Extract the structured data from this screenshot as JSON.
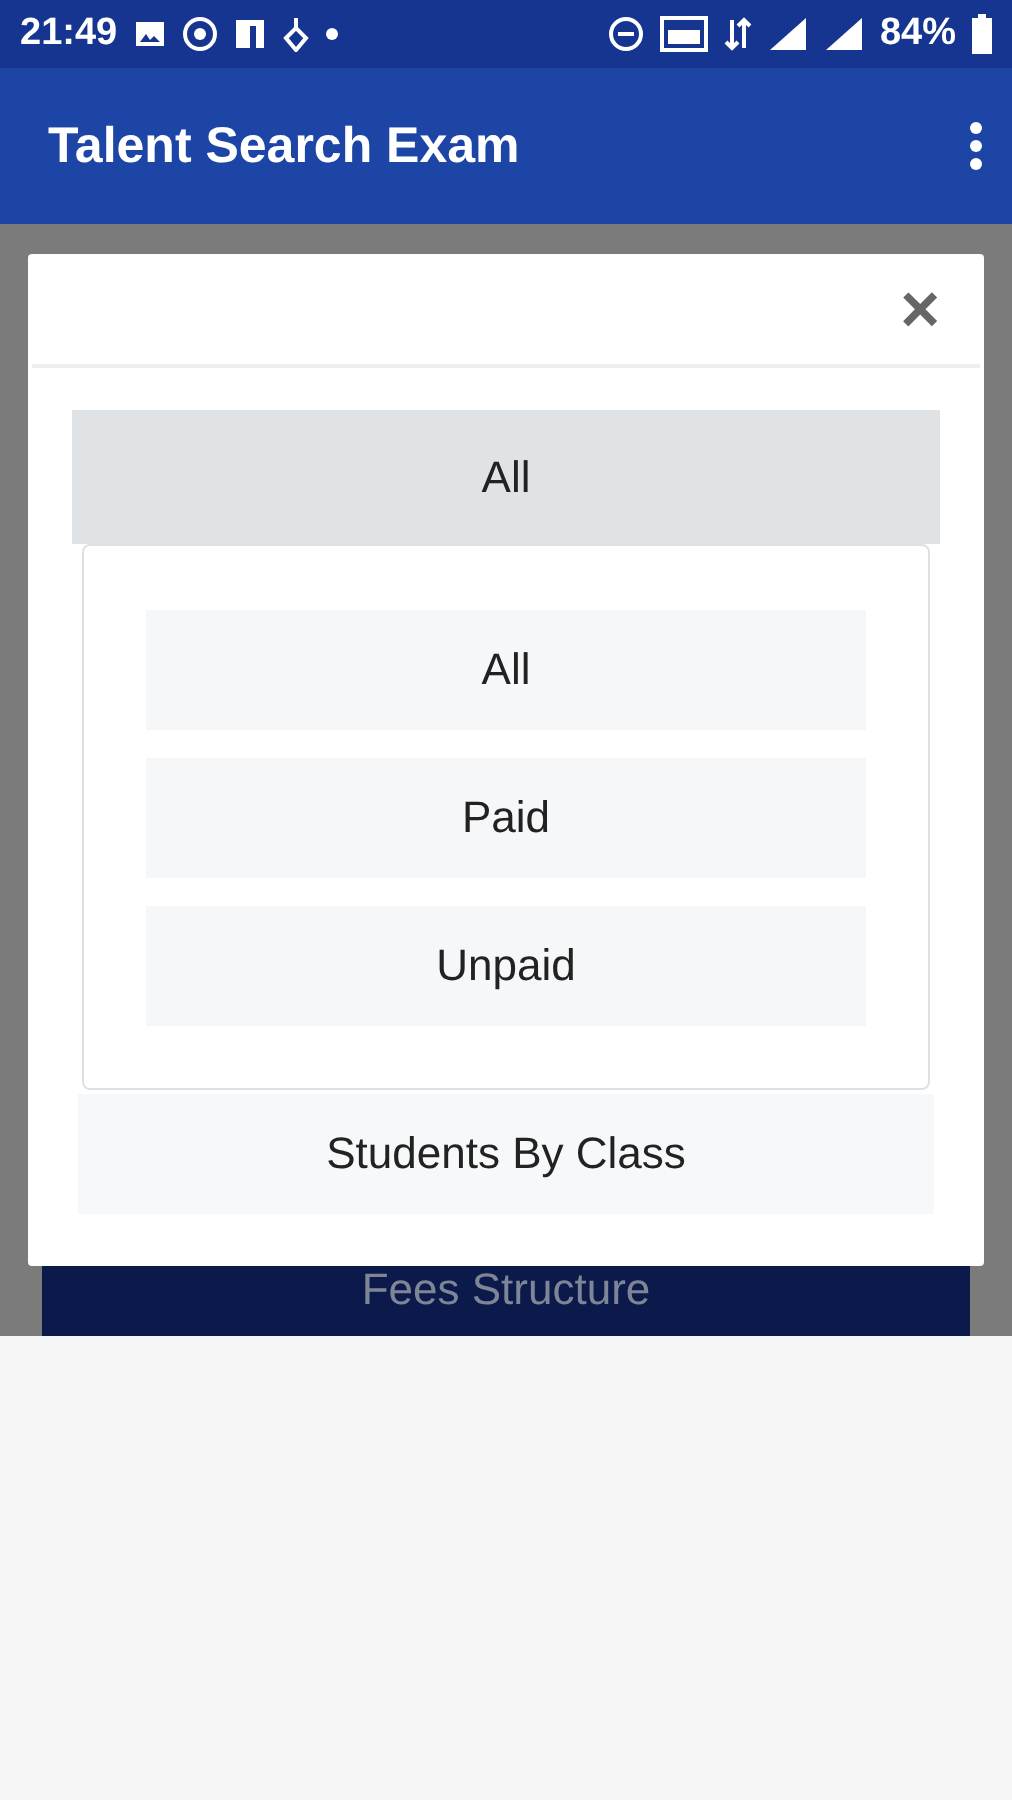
{
  "status_bar": {
    "time": "21:49",
    "battery": "84%"
  },
  "app_bar": {
    "title": "Talent Search Exam"
  },
  "background": {
    "button": "Fees Structure"
  },
  "dialog": {
    "close": "×",
    "dropdown": {
      "value": "All",
      "options": [
        {
          "label": "All"
        },
        {
          "label": "Paid"
        },
        {
          "label": "Unpaid"
        }
      ]
    },
    "next_item": "Students By Class"
  }
}
